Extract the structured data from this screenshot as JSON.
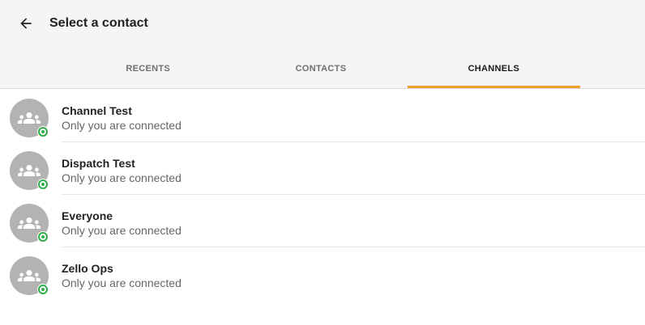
{
  "header": {
    "title": "Select a contact",
    "back_icon": "arrow-back-icon"
  },
  "tabs": [
    {
      "label": "RECENTS",
      "active": false
    },
    {
      "label": "CONTACTS",
      "active": false
    },
    {
      "label": "CHANNELS",
      "active": true
    }
  ],
  "colors": {
    "accent": "#f0a12c",
    "online": "#2fae4a",
    "avatar_bg": "#b3b3b3"
  },
  "channels": [
    {
      "name": "Channel Test",
      "status": "Only you are connected",
      "icon": "group-icon",
      "status_icon": "online-status-icon"
    },
    {
      "name": "Dispatch Test",
      "status": "Only you are connected",
      "icon": "group-icon",
      "status_icon": "online-status-icon"
    },
    {
      "name": "Everyone",
      "status": "Only you are connected",
      "icon": "group-icon",
      "status_icon": "online-status-icon"
    },
    {
      "name": "Zello Ops",
      "status": "Only you are connected",
      "icon": "group-icon",
      "status_icon": "online-status-icon"
    }
  ]
}
